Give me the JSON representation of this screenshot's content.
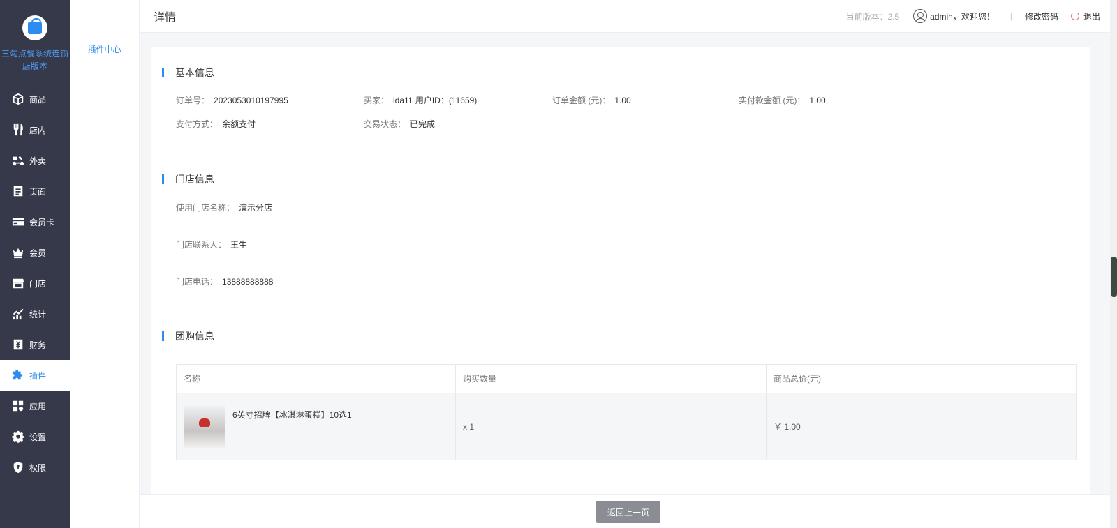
{
  "app": {
    "brand": "三勾点餐系统连锁店版本"
  },
  "nav": {
    "items": [
      {
        "label": "商品",
        "icon": "box-icon"
      },
      {
        "label": "店内",
        "icon": "fork-knife-icon"
      },
      {
        "label": "外卖",
        "icon": "scooter-icon"
      },
      {
        "label": "页面",
        "icon": "page-icon"
      },
      {
        "label": "会员卡",
        "icon": "card-icon"
      },
      {
        "label": "会员",
        "icon": "crown-icon"
      },
      {
        "label": "门店",
        "icon": "store-icon"
      },
      {
        "label": "统计",
        "icon": "chart-icon"
      },
      {
        "label": "财务",
        "icon": "finance-icon"
      },
      {
        "label": "插件",
        "icon": "puzzle-icon",
        "active": true
      },
      {
        "label": "应用",
        "icon": "apps-icon"
      },
      {
        "label": "设置",
        "icon": "gear-icon"
      },
      {
        "label": "权限",
        "icon": "shield-icon"
      }
    ]
  },
  "subnav": {
    "item": "插件中心"
  },
  "header": {
    "title": "详情",
    "version": "当前版本：2.5",
    "user": "admin，欢迎您！",
    "separator": "|",
    "change_password": "修改密码",
    "logout": "退出"
  },
  "basic": {
    "title": "基本信息",
    "order_no_label": "订单号：",
    "order_no": "2023053010197995",
    "buyer_label": "买家：",
    "buyer": "lda11 用户ID：(11659)",
    "amount_label": "订单金额 (元)：",
    "amount": "1.00",
    "paid_label": "实付款金额 (元)：",
    "paid": "1.00",
    "pay_method_label": "支付方式：",
    "pay_method": "余额支付",
    "status_label": "交易状态：",
    "status": "已完成"
  },
  "store": {
    "title": "门店信息",
    "name_label": "使用门店名称：",
    "name": "演示分店",
    "contact_label": "门店联系人：",
    "contact": "王生",
    "phone_label": "门店电话：",
    "phone": "13888888888"
  },
  "group": {
    "title": "团购信息",
    "headers": [
      "名称",
      "购买数量",
      "商品总价(元)"
    ],
    "rows": [
      {
        "name": "6英寸招牌【冰淇淋蛋糕】10选1",
        "qty": "x 1",
        "total": "￥ 1.00"
      }
    ]
  },
  "footer": {
    "back": "返回上一页"
  }
}
